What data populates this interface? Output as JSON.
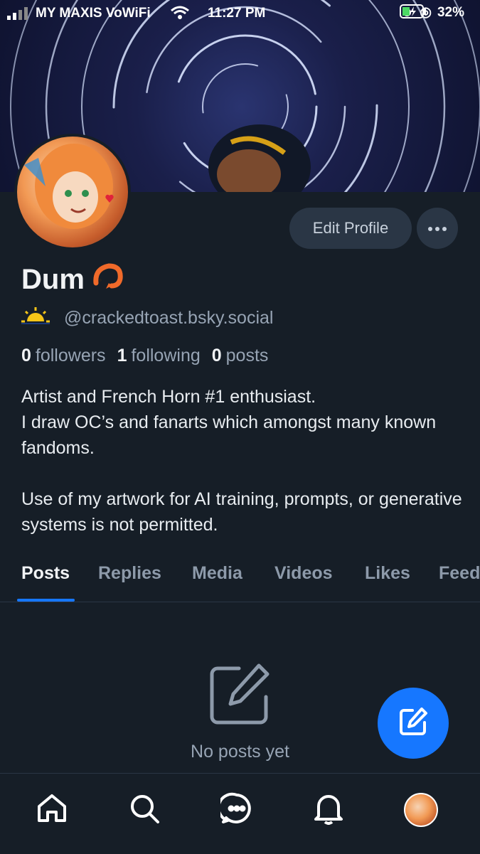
{
  "status_bar": {
    "carrier": "MY MAXIS VoWiFi",
    "time": "11:27 PM",
    "battery": "32%"
  },
  "profile": {
    "display_name": "Dum",
    "handle": "@crackedtoast.bsky.social",
    "followers_count": "0",
    "followers_label": "followers",
    "following_count": "1",
    "following_label": "following",
    "posts_count": "0",
    "posts_label": "posts",
    "bio": "Artist and French Horn #1 enthusiast.\nI draw OC’s and fanarts which amongst many known fandoms.\n\nUse of my artwork for AI training, prompts, or generative systems is not permitted."
  },
  "actions": {
    "edit_profile_label": "Edit Profile"
  },
  "tabs": [
    {
      "label": "Posts",
      "active": true
    },
    {
      "label": "Replies"
    },
    {
      "label": "Media"
    },
    {
      "label": "Videos"
    },
    {
      "label": "Likes"
    },
    {
      "label": "Feeds"
    }
  ],
  "empty_state": {
    "text": "No posts yet"
  },
  "colors": {
    "background": "#161e27",
    "accent": "#1677ff",
    "button": "#2a3645"
  },
  "icons": [
    "home-icon",
    "search-icon",
    "chat-icon",
    "bell-icon",
    "compose-icon",
    "more-icon"
  ]
}
